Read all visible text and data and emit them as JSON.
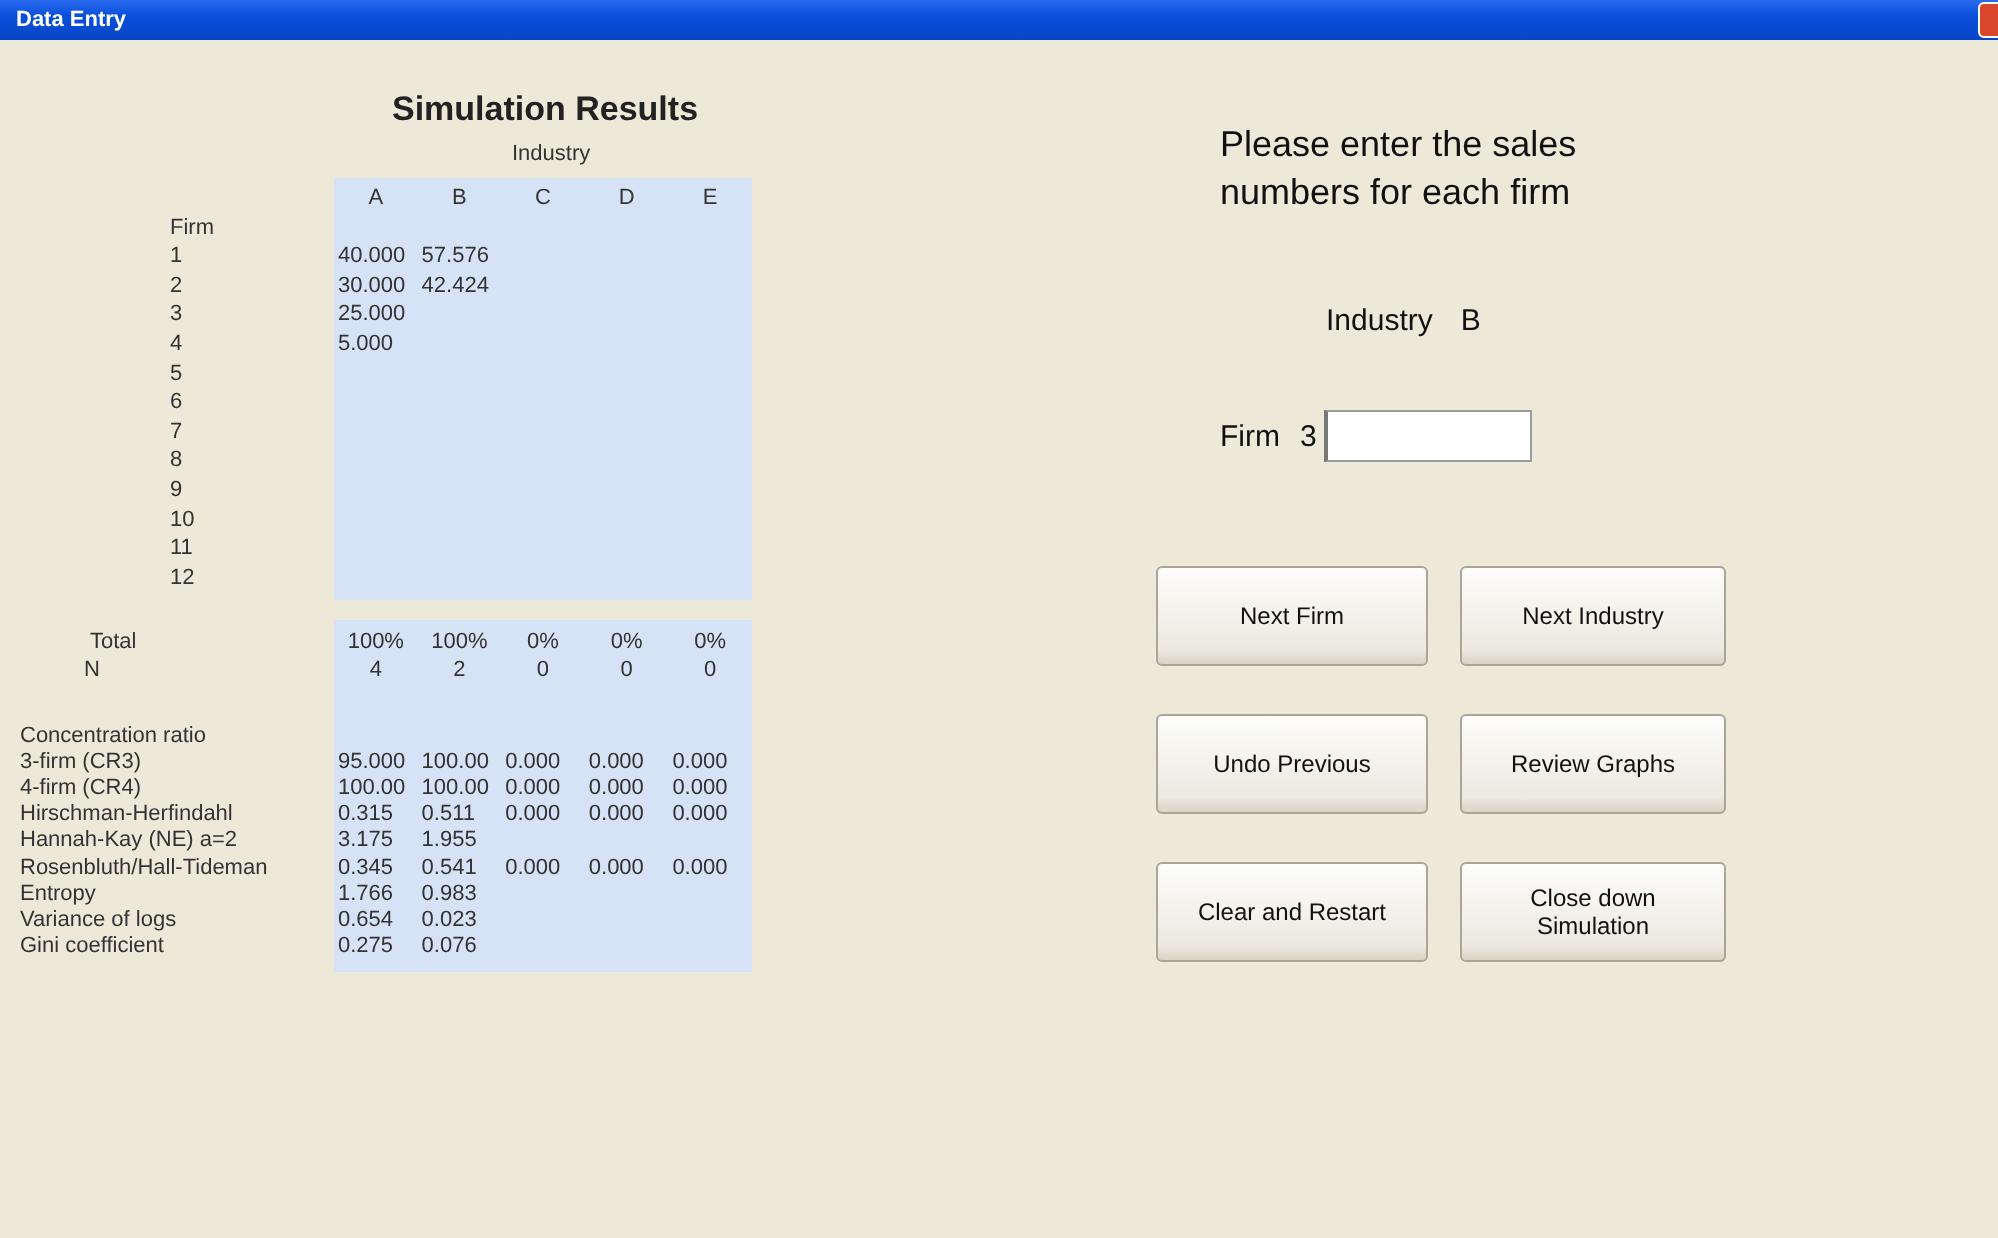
{
  "window": {
    "title": "Data Entry"
  },
  "results": {
    "title": "Simulation Results",
    "group_label": "Industry",
    "columns": [
      "A",
      "B",
      "C",
      "D",
      "E"
    ],
    "firm_header": "Firm",
    "firm_rows": [
      {
        "label": "1",
        "values": [
          "40.000",
          "57.576"
        ]
      },
      {
        "label": "2",
        "values": [
          "30.000",
          "42.424"
        ]
      },
      {
        "label": "3",
        "values": [
          "25.000"
        ]
      },
      {
        "label": "4",
        "values": [
          "5.000"
        ]
      },
      {
        "label": "5",
        "values": []
      },
      {
        "label": "6",
        "values": []
      },
      {
        "label": "7",
        "values": []
      },
      {
        "label": "8",
        "values": []
      },
      {
        "label": "9",
        "values": []
      },
      {
        "label": "10",
        "values": []
      },
      {
        "label": "11",
        "values": []
      },
      {
        "label": "12",
        "values": []
      }
    ],
    "totals": [
      {
        "label": "Total",
        "values": [
          "100%",
          "100%",
          "0%",
          "0%",
          "0%"
        ]
      },
      {
        "label": "N",
        "values": [
          "4",
          "2",
          "0",
          "0",
          "0"
        ]
      }
    ],
    "section_label": "Concentration ratio",
    "measures": [
      {
        "label": "3-firm (CR3)",
        "values": [
          "95.000",
          "100.00",
          "0.000",
          "0.000",
          "0.000"
        ]
      },
      {
        "label": "4-firm (CR4)",
        "values": [
          "100.00",
          "100.00",
          "0.000",
          "0.000",
          "0.000"
        ]
      },
      {
        "label": "Hirschman-Herfindahl",
        "values": [
          "0.315",
          "0.511",
          "0.000",
          "0.000",
          "0.000"
        ]
      },
      {
        "label": "Hannah-Kay (NE) a=2",
        "values": [
          "3.175",
          "1.955"
        ]
      },
      {
        "label": "Rosenbluth/Hall-Tideman",
        "values": [
          "0.345",
          "0.541",
          "0.000",
          "0.000",
          "0.000"
        ]
      },
      {
        "label": "Entropy",
        "values": [
          "1.766",
          "0.983"
        ]
      },
      {
        "label": "Variance of logs",
        "values": [
          "0.654",
          "0.023"
        ]
      },
      {
        "label": "Gini coefficient",
        "values": [
          "0.275",
          "0.076"
        ]
      }
    ]
  },
  "entry": {
    "prompt": "Please enter the sales numbers for each firm",
    "industry_label": "Industry",
    "industry_value": "B",
    "firm_label": "Firm",
    "firm_value": "3"
  },
  "buttons": [
    {
      "label": "Next Firm"
    },
    {
      "label": "Next Industry"
    },
    {
      "label": "Undo Previous"
    },
    {
      "label": "Review Graphs"
    },
    {
      "label": "Clear and Restart"
    },
    {
      "label": "Close down Simulation"
    }
  ]
}
